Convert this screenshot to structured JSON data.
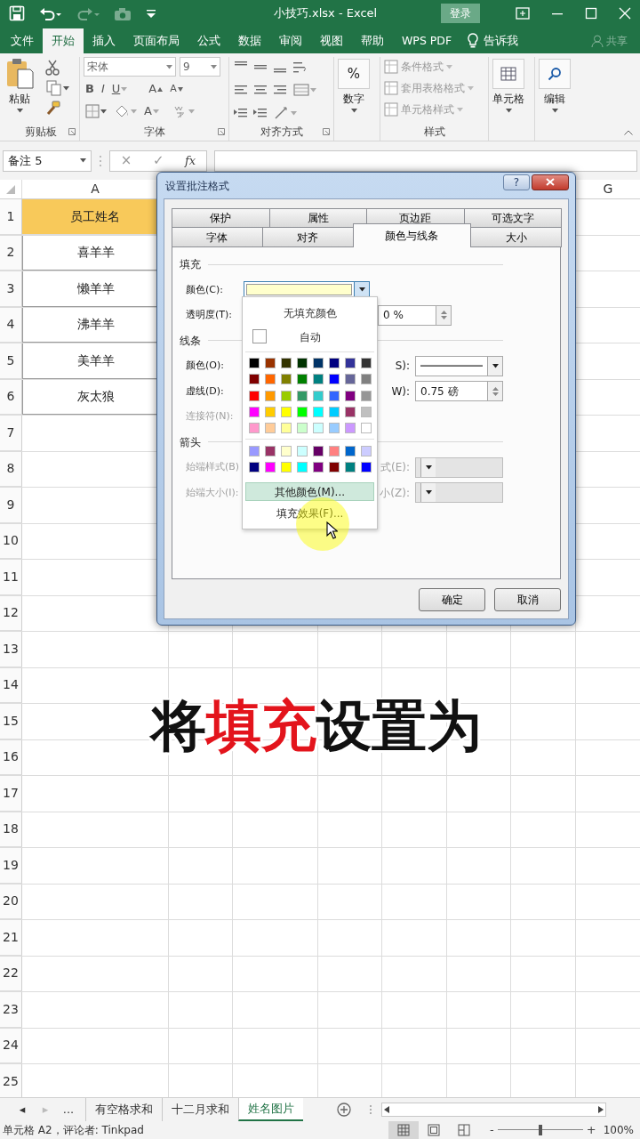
{
  "title_bar": {
    "quick_access": [
      {
        "kind": "save",
        "disabled": false
      },
      {
        "kind": "undo",
        "disabled": false
      },
      {
        "kind": "redo",
        "disabled": true
      },
      {
        "kind": "camera",
        "disabled": true
      },
      {
        "kind": "customize",
        "disabled": false
      }
    ],
    "title": "小技巧.xlsx - Excel",
    "sign_in": "登录"
  },
  "menu_tabs": [
    {
      "label": "文件",
      "selected": false
    },
    {
      "label": "开始",
      "selected": true
    },
    {
      "label": "插入",
      "selected": false
    },
    {
      "label": "页面布局",
      "selected": false
    },
    {
      "label": "公式",
      "selected": false
    },
    {
      "label": "数据",
      "selected": false
    },
    {
      "label": "审阅",
      "selected": false
    },
    {
      "label": "视图",
      "selected": false
    },
    {
      "label": "帮助",
      "selected": false
    },
    {
      "label": "WPS PDF",
      "selected": false
    }
  ],
  "tell_me": "告诉我",
  "share": "共享",
  "ribbon": {
    "clipboard": {
      "paste": "粘贴",
      "label": "剪贴板"
    },
    "font": {
      "name": "宋体",
      "size": "9",
      "bold": "B",
      "italic": "I",
      "underline": "U",
      "grow": "A",
      "shrink": "A",
      "font_color_label": "A",
      "label": "字体"
    },
    "alignment": {
      "label": "对齐方式"
    },
    "number": {
      "symbol": "%",
      "button": "数字"
    },
    "styles": {
      "items": [
        {
          "label": "条件格式",
          "disabled": true
        },
        {
          "label": "套用表格格式",
          "disabled": true
        },
        {
          "label": "单元格样式",
          "disabled": true
        }
      ],
      "label": "样式"
    },
    "cells": {
      "button": "单元格"
    },
    "editing": {
      "button": "编辑"
    }
  },
  "formula_bar": {
    "name_box": "备注 5",
    "cancel": "×",
    "enter": "✓",
    "function": "fx"
  },
  "sheet": {
    "column_headers": [
      "A",
      "G"
    ],
    "rows": [
      {
        "number": "1",
        "kind": "header",
        "value": "员工姓名"
      },
      {
        "number": "2",
        "kind": "data",
        "value": "喜羊羊"
      },
      {
        "number": "3",
        "kind": "data",
        "value": "懒羊羊"
      },
      {
        "number": "4",
        "kind": "data",
        "value": "沸羊羊"
      },
      {
        "number": "5",
        "kind": "data",
        "value": "美羊羊"
      },
      {
        "number": "6",
        "kind": "data",
        "value": "灰太狼"
      },
      {
        "number": "7",
        "kind": "data"
      },
      {
        "number": "8",
        "kind": "data"
      },
      {
        "number": "9",
        "kind": "data"
      },
      {
        "number": "10",
        "kind": "data"
      },
      {
        "number": "11",
        "kind": "data"
      },
      {
        "number": "12",
        "kind": "data"
      },
      {
        "number": "13",
        "kind": "data"
      },
      {
        "number": "14",
        "kind": "data"
      },
      {
        "number": "15",
        "kind": "data"
      },
      {
        "number": "16",
        "kind": "data"
      },
      {
        "number": "17",
        "kind": "data"
      },
      {
        "number": "18",
        "kind": "data"
      },
      {
        "number": "19",
        "kind": "data"
      },
      {
        "number": "20",
        "kind": "data"
      },
      {
        "number": "21",
        "kind": "data"
      },
      {
        "number": "22",
        "kind": "data"
      },
      {
        "number": "23",
        "kind": "data"
      },
      {
        "number": "24",
        "kind": "data"
      },
      {
        "number": "25",
        "kind": "data"
      }
    ]
  },
  "caption": [
    {
      "text": "将",
      "highlight": false
    },
    {
      "text": "填充",
      "highlight": true
    },
    {
      "text": "设置为",
      "highlight": false
    }
  ],
  "dialog": {
    "title": "设置批注格式",
    "help": "?",
    "tab_rows": [
      {
        "tabs": [
          {
            "label": "保护",
            "selected": false
          },
          {
            "label": "属性",
            "selected": false
          },
          {
            "label": "页边距",
            "selected": false
          },
          {
            "label": "可选文字",
            "selected": false
          }
        ]
      },
      {
        "tabs": [
          {
            "label": "字体",
            "selected": false
          },
          {
            "label": "对齐",
            "selected": false
          },
          {
            "label": "颜色与线条",
            "selected": true
          },
          {
            "label": "大小",
            "selected": false
          }
        ]
      }
    ],
    "sections": [
      {
        "title": "填充",
        "fields": [
          {
            "label": "颜色(C):",
            "disabled": false,
            "kind": "color",
            "color": "#ffffcc"
          },
          {
            "label": "透明度(T):",
            "disabled": false,
            "kind": "plain",
            "right": {
              "kind": "spin",
              "value": "0 %"
            }
          }
        ]
      },
      {
        "title": "线条",
        "fields": [
          {
            "label": "颜色(O):",
            "disabled": false,
            "kind": "plain",
            "right": {
              "label": "S):",
              "kind": "line"
            }
          },
          {
            "label": "虚线(D):",
            "disabled": false,
            "kind": "plain",
            "right": {
              "label": "W):",
              "kind": "spin",
              "value": "0.75 磅"
            }
          },
          {
            "label": "连接符(N):",
            "disabled": true,
            "kind": "plain"
          }
        ]
      },
      {
        "title": "箭头",
        "fields": [
          {
            "label": "始端样式(B)",
            "disabled": true,
            "kind": "plain",
            "right": {
              "label": "式(E):",
              "kind": "combo"
            }
          },
          {
            "label": "始端大小(I):",
            "disabled": true,
            "kind": "plain",
            "right": {
              "label": "小(Z):",
              "kind": "combo"
            }
          }
        ]
      }
    ],
    "buttons": [
      "确定",
      "取消"
    ]
  },
  "color_menu": {
    "no_fill": "无填充颜色",
    "automatic": "自动",
    "standard_colors": [
      {
        "color": "#000000"
      },
      {
        "color": "#993300"
      },
      {
        "color": "#333300"
      },
      {
        "color": "#003300"
      },
      {
        "color": "#003366"
      },
      {
        "color": "#000080"
      },
      {
        "color": "#333399"
      },
      {
        "color": "#333333"
      },
      {
        "color": "#800000"
      },
      {
        "color": "#ff6600"
      },
      {
        "color": "#808000"
      },
      {
        "color": "#008000"
      },
      {
        "color": "#008080"
      },
      {
        "color": "#0000ff"
      },
      {
        "color": "#666699"
      },
      {
        "color": "#808080"
      },
      {
        "color": "#ff0000"
      },
      {
        "color": "#ff9900"
      },
      {
        "color": "#99cc00"
      },
      {
        "color": "#339966"
      },
      {
        "color": "#33cccc"
      },
      {
        "color": "#3366ff"
      },
      {
        "color": "#800080"
      },
      {
        "color": "#969696"
      },
      {
        "color": "#ff00ff"
      },
      {
        "color": "#ffcc00"
      },
      {
        "color": "#ffff00"
      },
      {
        "color": "#00ff00"
      },
      {
        "color": "#00ffff"
      },
      {
        "color": "#00ccff"
      },
      {
        "color": "#993366"
      },
      {
        "color": "#c0c0c0"
      },
      {
        "color": "#ff99cc"
      },
      {
        "color": "#ffcc99"
      },
      {
        "color": "#ffff99"
      },
      {
        "color": "#ccffcc"
      },
      {
        "color": "#ccffff"
      },
      {
        "color": "#99ccff"
      },
      {
        "color": "#cc99ff"
      },
      {
        "color": "#ffffff"
      }
    ],
    "extra_colors": [
      {
        "color": "#9999ff"
      },
      {
        "color": "#993366"
      },
      {
        "color": "#ffffcc"
      },
      {
        "color": "#ccffff"
      },
      {
        "color": "#660066"
      },
      {
        "color": "#ff8080"
      },
      {
        "color": "#0066cc"
      },
      {
        "color": "#ccccff"
      },
      {
        "color": "#000080"
      },
      {
        "color": "#ff00ff"
      },
      {
        "color": "#ffff00"
      },
      {
        "color": "#00ffff"
      },
      {
        "color": "#800080"
      },
      {
        "color": "#800000"
      },
      {
        "color": "#008080"
      },
      {
        "color": "#0000ff"
      }
    ],
    "actions": [
      {
        "label": "其他颜色(M)...",
        "selected": true
      },
      {
        "label": "填充效果(F)...",
        "selected": false
      }
    ]
  },
  "sheet_tabs": {
    "nav": [
      {
        "label": "◂",
        "disabled": false
      },
      {
        "label": "▸",
        "disabled": true
      },
      {
        "label": "...",
        "disabled": false
      }
    ],
    "tabs": [
      {
        "label": "有空格求和",
        "selected": false
      },
      {
        "label": "十二月求和",
        "selected": false
      },
      {
        "label": "姓名图片",
        "selected": true
      }
    ]
  },
  "status_bar": {
    "text": "单元格 A2，评论者: Tinkpad",
    "views": [
      {
        "kind": "normal",
        "selected": true
      },
      {
        "kind": "page_layout",
        "selected": false
      },
      {
        "kind": "page_break",
        "selected": false
      }
    ],
    "zoom_out": "-",
    "zoom_in": "+",
    "zoom": {
      "level": 0.5
    },
    "zoom_reading": "100%"
  }
}
